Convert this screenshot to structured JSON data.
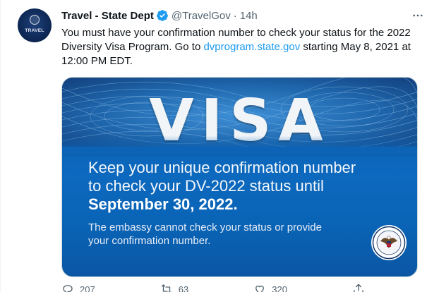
{
  "tweet": {
    "avatar_text": "TRAVEL",
    "author_name": "Travel - State Dept",
    "handle": "@TravelGov",
    "separator": "·",
    "time": "14h",
    "more_icon": "more-horizontal-icon",
    "text_before_link": "You must have your confirmation number to check your status for the 2022 Diversity Visa Program. Go to ",
    "link_text": "dvprogram.state.gov",
    "text_after_link": " starting May 8, 2021 at 12:00 PM EDT."
  },
  "media": {
    "headline_word": "VISA",
    "line1": "Keep your unique confirmation number",
    "line2": "to check your DV-2022 status until",
    "line3": "September 30, 2022.",
    "small1": "The embassy cannot check your status or provide",
    "small2": "your confirmation number."
  },
  "actions": {
    "reply_count": "207",
    "retweet_count": "63",
    "like_count": "320"
  },
  "colors": {
    "link": "#1d9bf0",
    "verified": "#1d9bf0",
    "muted": "#536471",
    "card_blue": "#0c69be"
  }
}
